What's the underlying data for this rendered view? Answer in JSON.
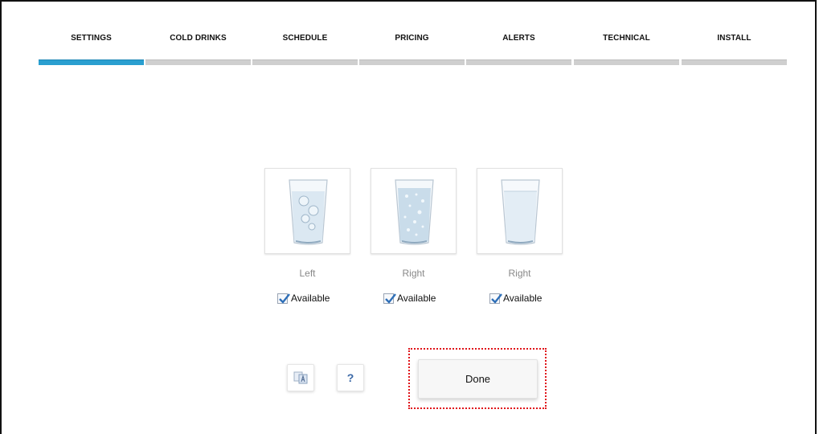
{
  "tabs": [
    {
      "label": "SETTINGS",
      "active": true
    },
    {
      "label": "COLD DRINKS",
      "active": false
    },
    {
      "label": "SCHEDULE",
      "active": false
    },
    {
      "label": "PRICING",
      "active": false
    },
    {
      "label": "ALERTS",
      "active": false
    },
    {
      "label": "TECHNICAL",
      "active": false
    },
    {
      "label": "INSTALL",
      "active": false
    }
  ],
  "drinks": [
    {
      "label": "Left",
      "image": "ice-water-glass-icon",
      "available_label": "Available",
      "available": true
    },
    {
      "label": "Right",
      "image": "sparkling-water-glass-icon",
      "available_label": "Available",
      "available": true
    },
    {
      "label": "Right",
      "image": "still-water-glass-icon",
      "available_label": "Available",
      "available": true
    }
  ],
  "footer": {
    "translate_icon": "translate-icon",
    "help_label": "?",
    "done_label": "Done"
  },
  "colors": {
    "active_tab": "#2a9fd0",
    "inactive_tab": "#cfcfcf",
    "highlight": "#e0141a"
  }
}
